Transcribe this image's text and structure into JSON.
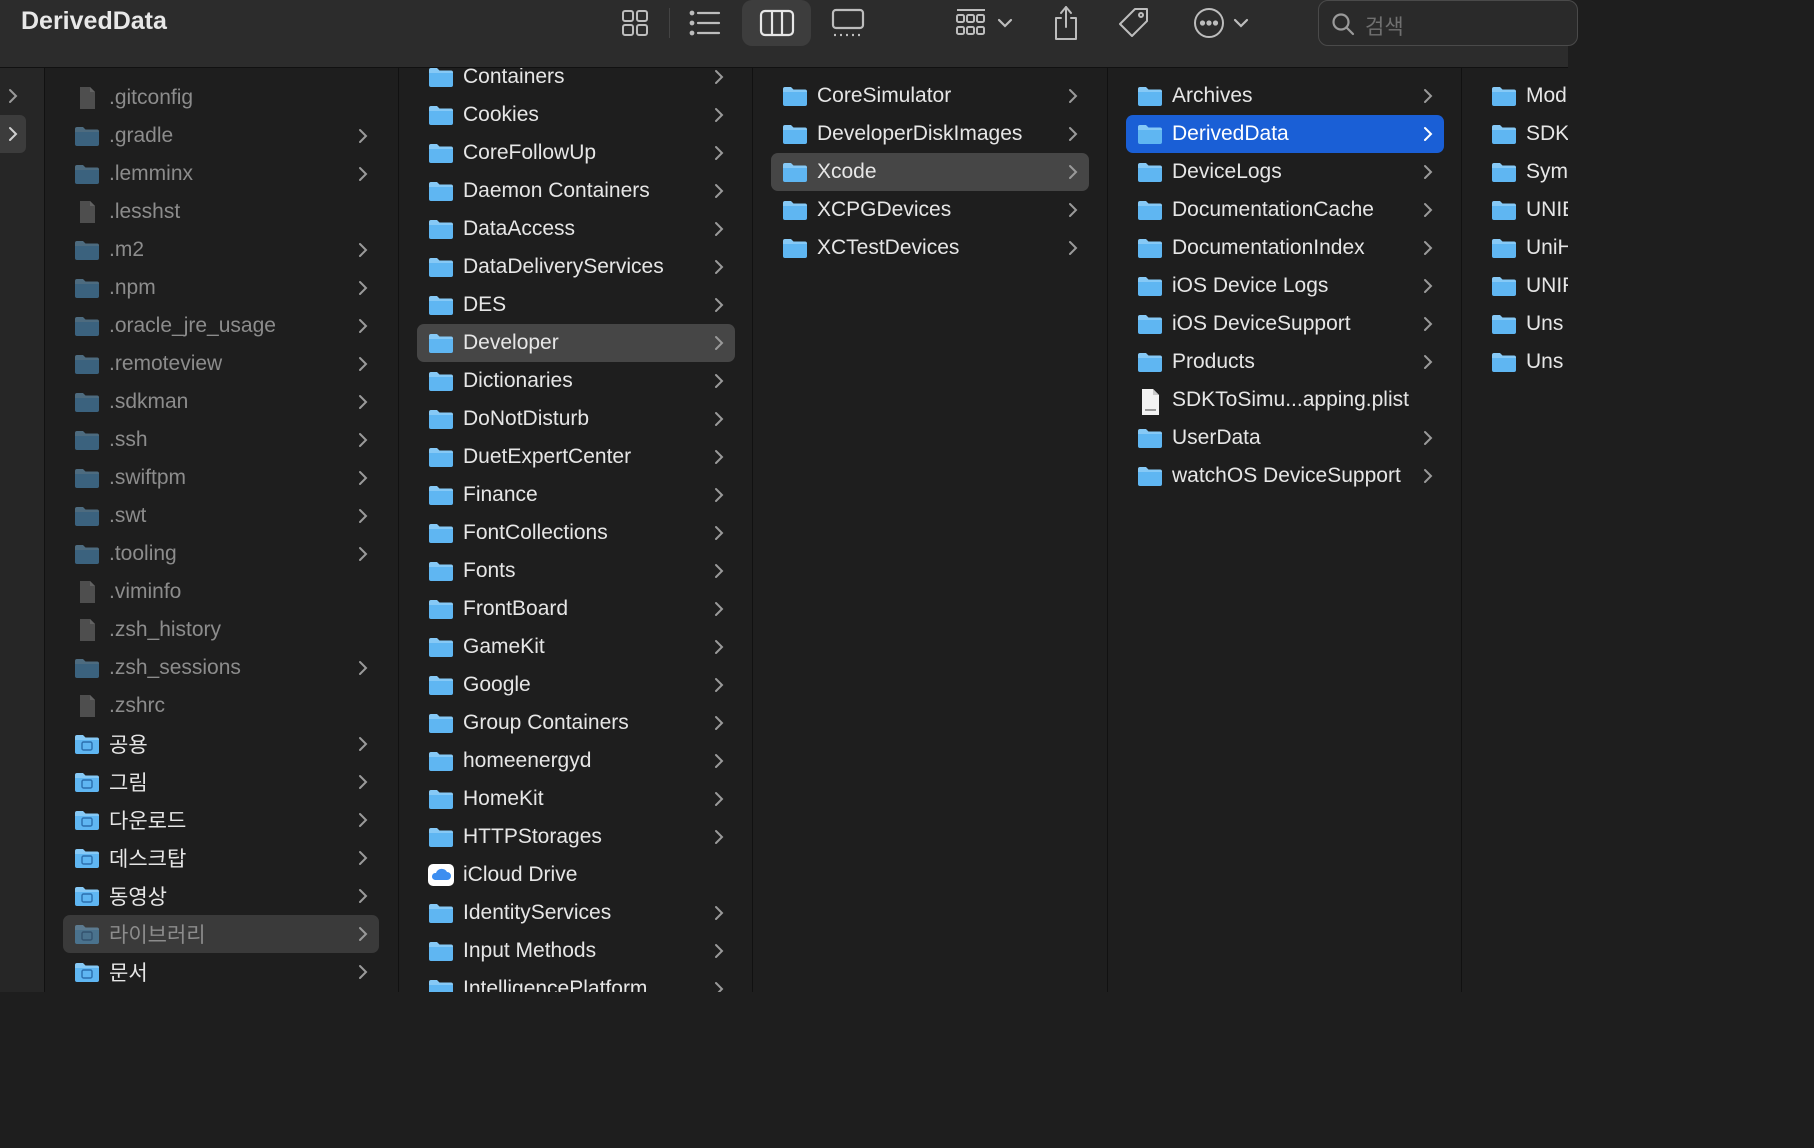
{
  "window": {
    "title": "DerivedData"
  },
  "toolbar": {
    "view_modes": [
      "icon-view-icon",
      "list-view-icon",
      "column-view-icon",
      "gallery-view-icon"
    ],
    "active_view": "column-view-icon",
    "search_placeholder": "검색"
  },
  "colors": {
    "accent": "#1a5fd6",
    "folder": "#5fb6f2",
    "background": "#1e1e1e"
  },
  "columns": [
    {
      "name": "home",
      "items": [
        {
          "label": ".gitconfig",
          "kind": "file",
          "dim": true,
          "chevron": false
        },
        {
          "label": ".gradle",
          "kind": "folder",
          "dim": true,
          "chevron": true
        },
        {
          "label": ".lemminx",
          "kind": "folder",
          "dim": true,
          "chevron": true
        },
        {
          "label": ".lesshst",
          "kind": "file",
          "dim": true,
          "chevron": false
        },
        {
          "label": ".m2",
          "kind": "folder",
          "dim": true,
          "chevron": true
        },
        {
          "label": ".npm",
          "kind": "folder",
          "dim": true,
          "chevron": true
        },
        {
          "label": ".oracle_jre_usage",
          "kind": "folder",
          "dim": true,
          "chevron": true
        },
        {
          "label": ".remoteview",
          "kind": "folder",
          "dim": true,
          "chevron": true
        },
        {
          "label": ".sdkman",
          "kind": "folder",
          "dim": true,
          "chevron": true
        },
        {
          "label": ".ssh",
          "kind": "folder",
          "dim": true,
          "chevron": true
        },
        {
          "label": ".swiftpm",
          "kind": "folder",
          "dim": true,
          "chevron": true
        },
        {
          "label": ".swt",
          "kind": "folder",
          "dim": true,
          "chevron": true
        },
        {
          "label": ".tooling",
          "kind": "folder",
          "dim": true,
          "chevron": true
        },
        {
          "label": ".viminfo",
          "kind": "file",
          "dim": true,
          "chevron": false
        },
        {
          "label": ".zsh_history",
          "kind": "file",
          "dim": true,
          "chevron": false
        },
        {
          "label": ".zsh_sessions",
          "kind": "folder",
          "dim": true,
          "chevron": true
        },
        {
          "label": ".zshrc",
          "kind": "file",
          "dim": true,
          "chevron": false
        },
        {
          "label": "공용",
          "kind": "folder-public",
          "dim": false,
          "chevron": true
        },
        {
          "label": "그림",
          "kind": "folder-pictures",
          "dim": false,
          "chevron": true
        },
        {
          "label": "다운로드",
          "kind": "folder-downloads",
          "dim": false,
          "chevron": true
        },
        {
          "label": "데스크탑",
          "kind": "folder-desktop",
          "dim": false,
          "chevron": true
        },
        {
          "label": "동영상",
          "kind": "folder-movies",
          "dim": false,
          "chevron": true
        },
        {
          "label": "라이브러리",
          "kind": "folder-library",
          "dim": true,
          "chevron": true,
          "selected": "gray"
        },
        {
          "label": "문서",
          "kind": "folder-documents",
          "dim": false,
          "chevron": true
        }
      ]
    },
    {
      "name": "library",
      "items": [
        {
          "label": "Containers",
          "kind": "folder",
          "chevron": true
        },
        {
          "label": "Cookies",
          "kind": "folder",
          "chevron": true
        },
        {
          "label": "CoreFollowUp",
          "kind": "folder",
          "chevron": true
        },
        {
          "label": "Daemon Containers",
          "kind": "folder",
          "chevron": true
        },
        {
          "label": "DataAccess",
          "kind": "folder",
          "chevron": true
        },
        {
          "label": "DataDeliveryServices",
          "kind": "folder",
          "chevron": true
        },
        {
          "label": "DES",
          "kind": "folder",
          "chevron": true
        },
        {
          "label": "Developer",
          "kind": "folder",
          "chevron": true,
          "selected": "gray"
        },
        {
          "label": "Dictionaries",
          "kind": "folder",
          "chevron": true
        },
        {
          "label": "DoNotDisturb",
          "kind": "folder",
          "chevron": true
        },
        {
          "label": "DuetExpertCenter",
          "kind": "folder",
          "chevron": true
        },
        {
          "label": "Finance",
          "kind": "folder",
          "chevron": true
        },
        {
          "label": "FontCollections",
          "kind": "folder",
          "chevron": true
        },
        {
          "label": "Fonts",
          "kind": "folder",
          "chevron": true
        },
        {
          "label": "FrontBoard",
          "kind": "folder",
          "chevron": true
        },
        {
          "label": "GameKit",
          "kind": "folder",
          "chevron": true
        },
        {
          "label": "Google",
          "kind": "folder",
          "chevron": true
        },
        {
          "label": "Group Containers",
          "kind": "folder",
          "chevron": true
        },
        {
          "label": "homeenergyd",
          "kind": "folder",
          "chevron": true
        },
        {
          "label": "HomeKit",
          "kind": "folder",
          "chevron": true
        },
        {
          "label": "HTTPStorages",
          "kind": "folder",
          "chevron": true
        },
        {
          "label": "iCloud Drive",
          "kind": "icloud",
          "chevron": false
        },
        {
          "label": "IdentityServices",
          "kind": "folder",
          "chevron": true
        },
        {
          "label": "Input Methods",
          "kind": "folder",
          "chevron": true
        },
        {
          "label": "IntelligencePlatform",
          "kind": "folder",
          "chevron": true
        }
      ]
    },
    {
      "name": "developer",
      "items": [
        {
          "label": "CoreSimulator",
          "kind": "folder",
          "chevron": true
        },
        {
          "label": "DeveloperDiskImages",
          "kind": "folder",
          "chevron": true
        },
        {
          "label": "Xcode",
          "kind": "folder",
          "chevron": true,
          "selected": "gray"
        },
        {
          "label": "XCPGDevices",
          "kind": "folder",
          "chevron": true
        },
        {
          "label": "XCTestDevices",
          "kind": "folder",
          "chevron": true
        }
      ]
    },
    {
      "name": "xcode",
      "items": [
        {
          "label": "Archives",
          "kind": "folder",
          "chevron": true
        },
        {
          "label": "DerivedData",
          "kind": "folder",
          "chevron": true,
          "selected": "blue"
        },
        {
          "label": "DeviceLogs",
          "kind": "folder",
          "chevron": true
        },
        {
          "label": "DocumentationCache",
          "kind": "folder",
          "chevron": true
        },
        {
          "label": "DocumentationIndex",
          "kind": "folder",
          "chevron": true
        },
        {
          "label": "iOS Device Logs",
          "kind": "folder",
          "chevron": true
        },
        {
          "label": "iOS DeviceSupport",
          "kind": "folder",
          "chevron": true
        },
        {
          "label": "Products",
          "kind": "folder",
          "chevron": true
        },
        {
          "label": "SDKToSimu...apping.plist",
          "kind": "plist",
          "chevron": false
        },
        {
          "label": "UserData",
          "kind": "folder",
          "chevron": true
        },
        {
          "label": "watchOS DeviceSupport",
          "kind": "folder",
          "chevron": true
        }
      ]
    },
    {
      "name": "deriveddata",
      "items": [
        {
          "label": "Mod",
          "kind": "folder",
          "chevron": false
        },
        {
          "label": "SDK",
          "kind": "folder",
          "chevron": false
        },
        {
          "label": "Sym",
          "kind": "folder",
          "chevron": false
        },
        {
          "label": "UNIE",
          "kind": "folder",
          "chevron": false
        },
        {
          "label": "UniH",
          "kind": "folder",
          "chevron": false
        },
        {
          "label": "UNIF",
          "kind": "folder",
          "chevron": false
        },
        {
          "label": "Uns",
          "kind": "folder",
          "chevron": false
        },
        {
          "label": "Uns",
          "kind": "folder",
          "chevron": false
        }
      ]
    }
  ]
}
